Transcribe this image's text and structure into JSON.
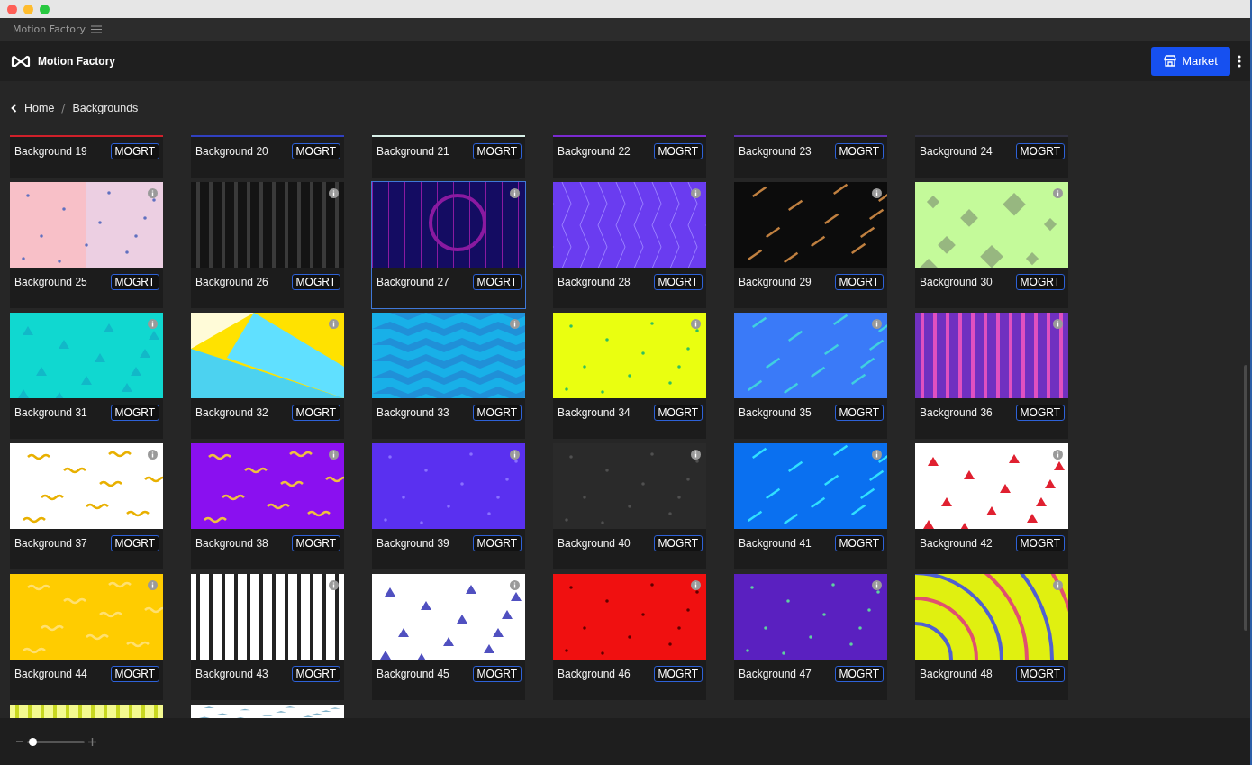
{
  "window": {
    "title": "Motion Factory"
  },
  "header": {
    "app_name": "Motion Factory",
    "market_button": "Market"
  },
  "breadcrumb": {
    "items": [
      {
        "label": "Home"
      },
      {
        "label": "Backgrounds"
      }
    ],
    "separator": "/"
  },
  "cards": [
    {
      "kind": "cut_top",
      "name": "Background 19",
      "badge": "MOGRT",
      "color": "#d0202a",
      "selected": false
    },
    {
      "kind": "cut_top",
      "name": "Background 20",
      "badge": "MOGRT",
      "color": "#3040c0",
      "selected": false
    },
    {
      "kind": "cut_top",
      "name": "Background 21",
      "badge": "MOGRT",
      "color": "#d8f0e8",
      "selected": false
    },
    {
      "kind": "cut_top",
      "name": "Background 22",
      "badge": "MOGRT",
      "color": "#7a2ad0",
      "selected": false
    },
    {
      "kind": "cut_top",
      "name": "Background 23",
      "badge": "MOGRT",
      "color": "#6030b0",
      "selected": false
    },
    {
      "kind": "cut_top",
      "name": "Background 24",
      "badge": "MOGRT",
      "color": "#303040",
      "selected": false
    },
    {
      "kind": "full",
      "name": "Background 25",
      "badge": "MOGRT",
      "selected": false
    },
    {
      "kind": "full",
      "name": "Background 26",
      "badge": "MOGRT",
      "selected": false
    },
    {
      "kind": "full",
      "name": "Background 27",
      "badge": "MOGRT",
      "selected": true
    },
    {
      "kind": "full",
      "name": "Background 28",
      "badge": "MOGRT",
      "selected": false
    },
    {
      "kind": "full",
      "name": "Background 29",
      "badge": "MOGRT",
      "selected": false
    },
    {
      "kind": "full",
      "name": "Background 30",
      "badge": "MOGRT",
      "selected": false
    },
    {
      "kind": "full",
      "name": "Background 31",
      "badge": "MOGRT",
      "selected": false
    },
    {
      "kind": "full",
      "name": "Background 32",
      "badge": "MOGRT",
      "selected": false
    },
    {
      "kind": "full",
      "name": "Background 33",
      "badge": "MOGRT",
      "selected": false
    },
    {
      "kind": "full",
      "name": "Background 34",
      "badge": "MOGRT",
      "selected": false
    },
    {
      "kind": "full",
      "name": "Background 35",
      "badge": "MOGRT",
      "selected": false
    },
    {
      "kind": "full",
      "name": "Background 36",
      "badge": "MOGRT",
      "selected": false
    },
    {
      "kind": "full",
      "name": "Background 37",
      "badge": "MOGRT",
      "selected": false
    },
    {
      "kind": "full",
      "name": "Background 38",
      "badge": "MOGRT",
      "selected": false
    },
    {
      "kind": "full",
      "name": "Background 39",
      "badge": "MOGRT",
      "selected": false
    },
    {
      "kind": "full",
      "name": "Background 40",
      "badge": "MOGRT",
      "selected": false
    },
    {
      "kind": "full",
      "name": "Background 41",
      "badge": "MOGRT",
      "selected": false
    },
    {
      "kind": "full",
      "name": "Background 42",
      "badge": "MOGRT",
      "selected": false
    },
    {
      "kind": "full",
      "name": "Background 44",
      "badge": "MOGRT",
      "selected": false
    },
    {
      "kind": "full",
      "name": "Background 43",
      "badge": "MOGRT",
      "selected": false
    },
    {
      "kind": "full",
      "name": "Background 45",
      "badge": "MOGRT",
      "selected": false
    },
    {
      "kind": "full",
      "name": "Background 46",
      "badge": "MOGRT",
      "selected": false
    },
    {
      "kind": "full",
      "name": "Background 47",
      "badge": "MOGRT",
      "selected": false
    },
    {
      "kind": "full",
      "name": "Background 48",
      "badge": "MOGRT",
      "selected": false
    },
    {
      "kind": "peek"
    },
    {
      "kind": "peek"
    }
  ],
  "zoom_slider": {
    "level": 0.1
  }
}
